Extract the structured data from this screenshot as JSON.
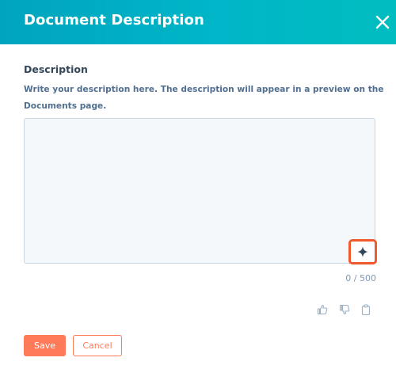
{
  "dialog": {
    "title": "Document Description",
    "close_icon": "close-icon"
  },
  "description": {
    "label": "Description",
    "help_text": "Write your description here. The description will appear in a preview on the Documents page.",
    "value": "",
    "placeholder": "",
    "ai_assist_icon": "sparkle-icon",
    "char_count": "0 / 500"
  },
  "feedback": {
    "thumbs_up_icon": "thumbs-up-icon",
    "thumbs_down_icon": "thumbs-down-icon",
    "copy_icon": "clipboard-icon"
  },
  "actions": {
    "save_label": "Save",
    "cancel_label": "Cancel"
  },
  "colors": {
    "header_teal": "#00a4bd",
    "accent_orange": "#ff7a59",
    "highlight_red": "#f0582e"
  }
}
